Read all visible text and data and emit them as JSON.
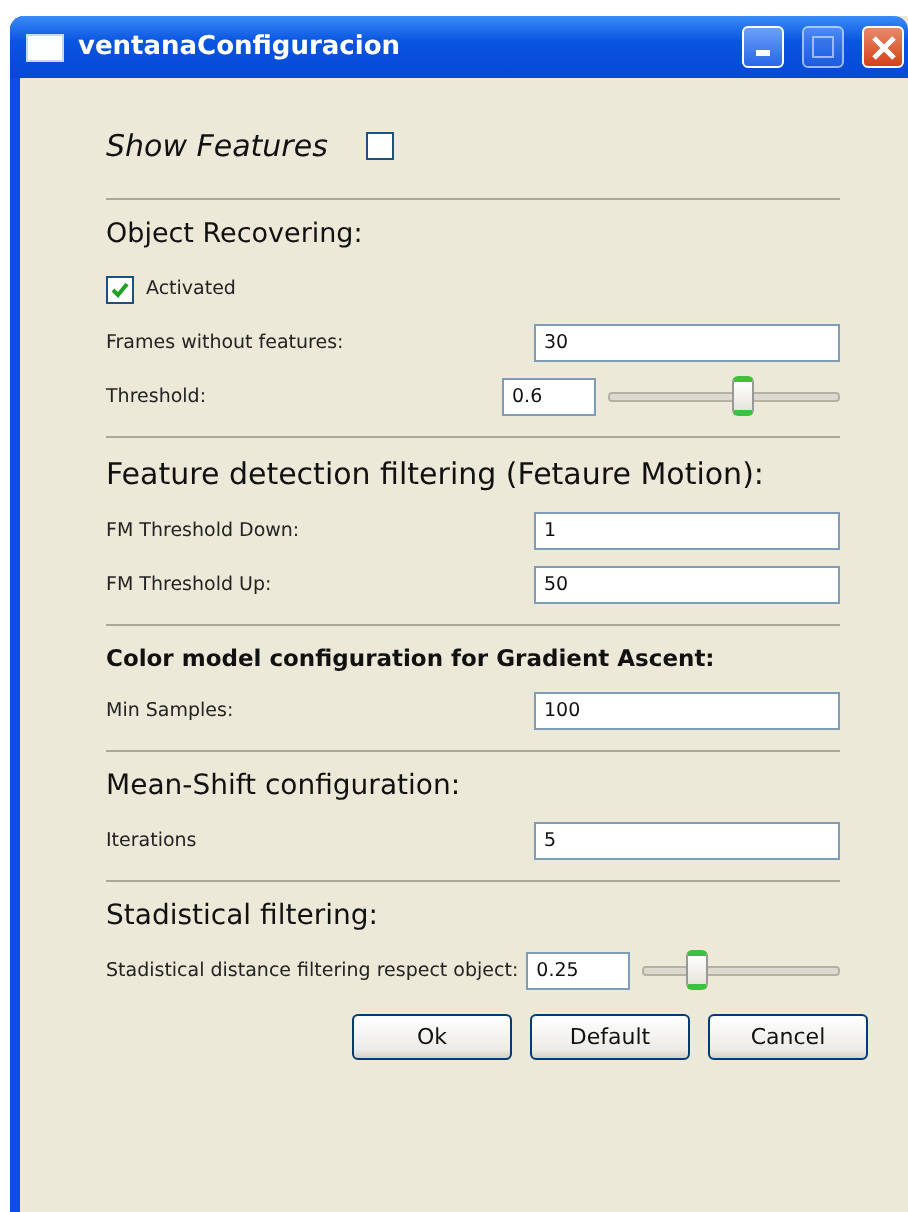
{
  "window": {
    "title": "ventanaConfiguracion"
  },
  "show_features": {
    "label": "Show Features",
    "checked": false
  },
  "sections": [
    {
      "heading": "Object Recovering:",
      "rows": [
        {
          "kind": "checkbox",
          "label": "Activated",
          "checked": true
        },
        {
          "kind": "field",
          "label": "Frames without features:",
          "value": "30"
        },
        {
          "kind": "slider",
          "label": "Threshold:",
          "value": "0.6",
          "level": 0.58
        }
      ]
    },
    {
      "heading": "Feature detection filtering (Fetaure Motion):",
      "rows": [
        {
          "kind": "field",
          "label": "FM Threshold Down:",
          "value": "1"
        },
        {
          "kind": "field",
          "label": "FM Threshold Up:",
          "value": "50"
        }
      ]
    },
    {
      "heading": "Color model configuration for Gradient Ascent:",
      "rows": [
        {
          "kind": "field",
          "label": "Min Samples:",
          "value": "100"
        }
      ]
    },
    {
      "heading": "Mean-Shift configuration:",
      "rows": [
        {
          "kind": "field",
          "label": "Iterations",
          "value": "5"
        }
      ]
    },
    {
      "heading": "Stadistical filtering:",
      "rows": [
        {
          "kind": "slider",
          "label": "Stadistical distance filtering respect object:",
          "value": "0.25",
          "level": 0.27
        }
      ]
    }
  ],
  "buttons": [
    "Ok",
    "Default",
    "Cancel"
  ]
}
